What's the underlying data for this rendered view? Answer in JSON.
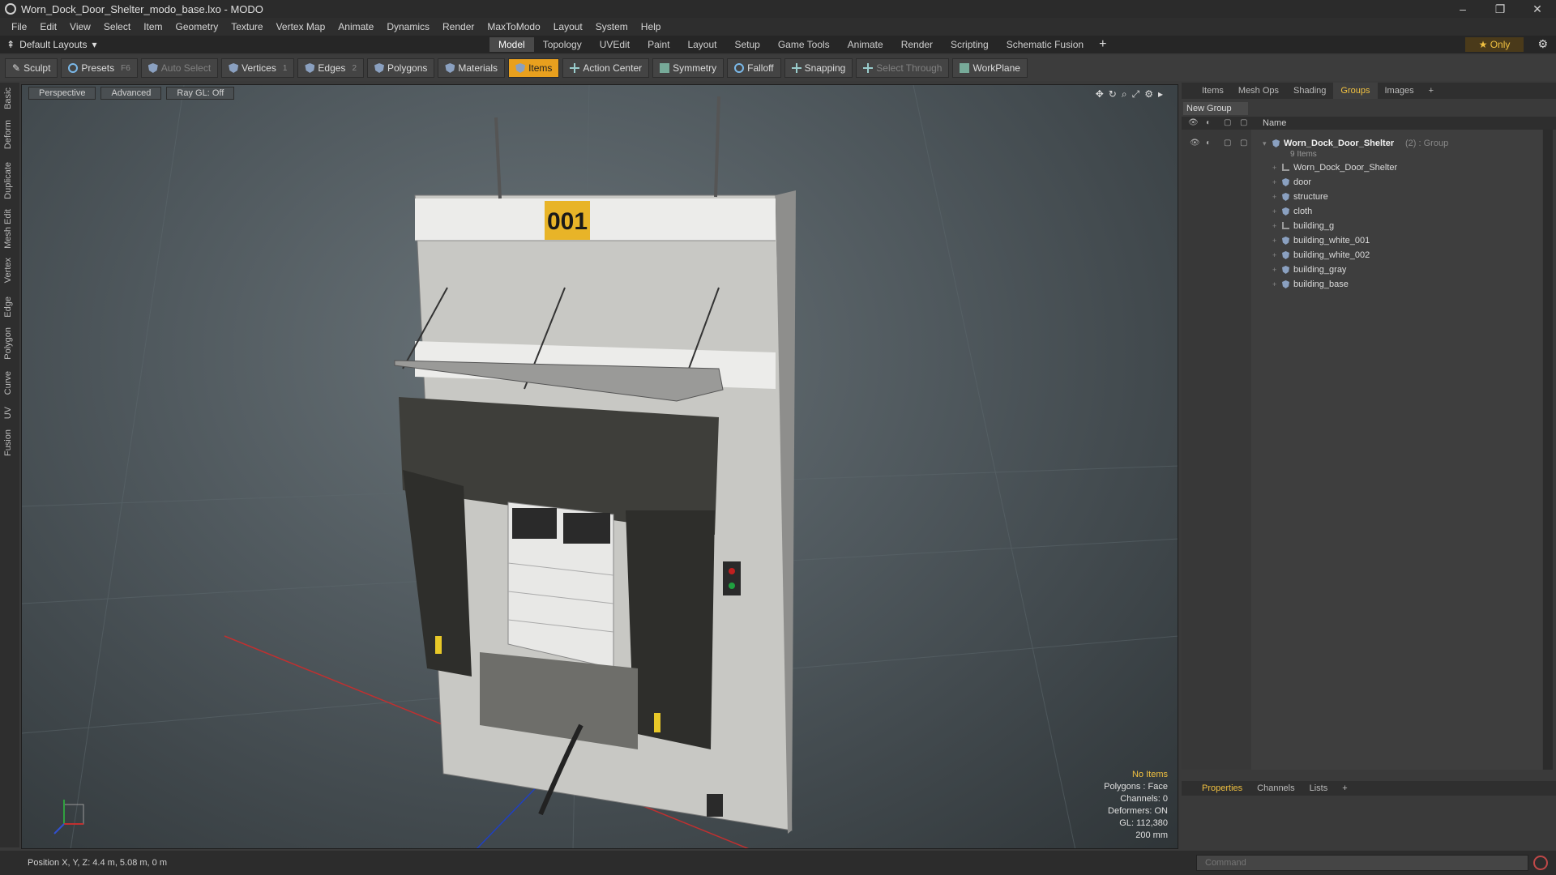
{
  "window": {
    "title": "Worn_Dock_Door_Shelter_modo_base.lxo - MODO",
    "minimize": "–",
    "maximize": "❐",
    "close": "✕"
  },
  "menu": [
    "File",
    "Edit",
    "View",
    "Select",
    "Item",
    "Geometry",
    "Texture",
    "Vertex Map",
    "Animate",
    "Dynamics",
    "Render",
    "MaxToModo",
    "Layout",
    "System",
    "Help"
  ],
  "layoutbar": {
    "layout": "Default Layouts",
    "tabs": [
      "Model",
      "Topology",
      "UVEdit",
      "Paint",
      "Layout",
      "Setup",
      "Game Tools",
      "Animate",
      "Render",
      "Scripting",
      "Schematic Fusion"
    ],
    "active_tab": "Model",
    "add": "+",
    "only": "★  Only"
  },
  "toolbar": {
    "sculpt": "Sculpt",
    "presets": "Presets",
    "presets_key": "F6",
    "auto_select": "Auto Select",
    "vertices": "Vertices",
    "vertices_key": "1",
    "edges": "Edges",
    "edges_key": "2",
    "polygons": "Polygons",
    "materials": "Materials",
    "items": "Items",
    "action_center": "Action Center",
    "symmetry": "Symmetry",
    "falloff": "Falloff",
    "snapping": "Snapping",
    "select_through": "Select Through",
    "workplane": "WorkPlane"
  },
  "left_tabs": [
    "Basic",
    "Deform",
    "Duplicate",
    "Mesh Edit",
    "Vertex",
    "Edge",
    "Polygon",
    "Curve",
    "UV",
    "Fusion"
  ],
  "viewport": {
    "perspective": "Perspective",
    "advanced": "Advanced",
    "raygl": "Ray GL: Off",
    "sign_number": "001",
    "info": {
      "no_items": "No Items",
      "polygons": "Polygons : Face",
      "channels": "Channels: 0",
      "deformers": "Deformers: ON",
      "gl": "GL: 112,380",
      "scale": "200 mm"
    }
  },
  "right_panel": {
    "tabs": [
      "Items",
      "Mesh Ops",
      "Shading",
      "Groups",
      "Images"
    ],
    "active_tab": "Groups",
    "add": "+",
    "new_group": "New Group",
    "name_col": "Name",
    "group": {
      "name": "Worn_Dock_Door_Shelter",
      "meta": "(2) : Group",
      "count": "9 Items",
      "children": [
        {
          "label": "Worn_Dock_Door_Shelter",
          "icon": "locator-icon"
        },
        {
          "label": "door",
          "icon": "mesh-icon"
        },
        {
          "label": "structure",
          "icon": "mesh-icon"
        },
        {
          "label": "cloth",
          "icon": "mesh-icon"
        },
        {
          "label": "building_g",
          "icon": "locator-icon"
        },
        {
          "label": "building_white_001",
          "icon": "mesh-icon"
        },
        {
          "label": "building_white_002",
          "icon": "mesh-icon"
        },
        {
          "label": "building_gray",
          "icon": "mesh-icon"
        },
        {
          "label": "building_base",
          "icon": "mesh-icon"
        }
      ]
    },
    "bottom_tabs": [
      "Properties",
      "Channels",
      "Lists"
    ],
    "bottom_active": "Properties"
  },
  "status": {
    "position": "Position X, Y, Z:   4.4 m, 5.08 m, 0 m",
    "command_placeholder": "Command"
  },
  "colors": {
    "accent": "#f0c040",
    "active_tool": "#e8a01e",
    "background": "#3a3a3a"
  }
}
